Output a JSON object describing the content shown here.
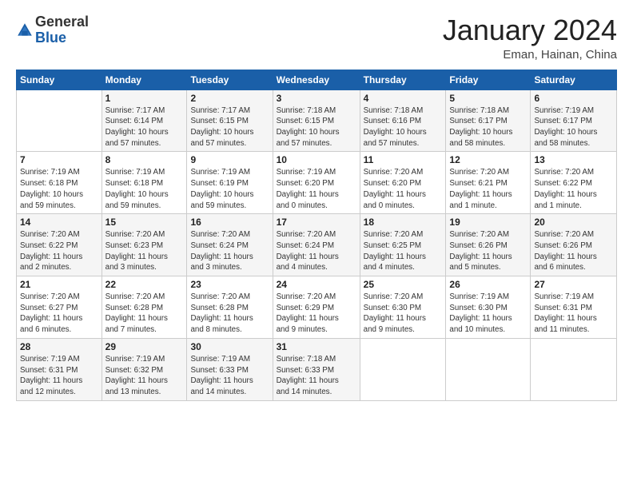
{
  "logo": {
    "general": "General",
    "blue": "Blue"
  },
  "title": {
    "month_year": "January 2024",
    "location": "Eman, Hainan, China"
  },
  "days_of_week": [
    "Sunday",
    "Monday",
    "Tuesday",
    "Wednesday",
    "Thursday",
    "Friday",
    "Saturday"
  ],
  "weeks": [
    [
      {
        "day": "",
        "info": ""
      },
      {
        "day": "1",
        "info": "Sunrise: 7:17 AM\nSunset: 6:14 PM\nDaylight: 10 hours\nand 57 minutes."
      },
      {
        "day": "2",
        "info": "Sunrise: 7:17 AM\nSunset: 6:15 PM\nDaylight: 10 hours\nand 57 minutes."
      },
      {
        "day": "3",
        "info": "Sunrise: 7:18 AM\nSunset: 6:15 PM\nDaylight: 10 hours\nand 57 minutes."
      },
      {
        "day": "4",
        "info": "Sunrise: 7:18 AM\nSunset: 6:16 PM\nDaylight: 10 hours\nand 57 minutes."
      },
      {
        "day": "5",
        "info": "Sunrise: 7:18 AM\nSunset: 6:17 PM\nDaylight: 10 hours\nand 58 minutes."
      },
      {
        "day": "6",
        "info": "Sunrise: 7:19 AM\nSunset: 6:17 PM\nDaylight: 10 hours\nand 58 minutes."
      }
    ],
    [
      {
        "day": "7",
        "info": "Sunrise: 7:19 AM\nSunset: 6:18 PM\nDaylight: 10 hours\nand 59 minutes."
      },
      {
        "day": "8",
        "info": "Sunrise: 7:19 AM\nSunset: 6:18 PM\nDaylight: 10 hours\nand 59 minutes."
      },
      {
        "day": "9",
        "info": "Sunrise: 7:19 AM\nSunset: 6:19 PM\nDaylight: 10 hours\nand 59 minutes."
      },
      {
        "day": "10",
        "info": "Sunrise: 7:19 AM\nSunset: 6:20 PM\nDaylight: 11 hours\nand 0 minutes."
      },
      {
        "day": "11",
        "info": "Sunrise: 7:20 AM\nSunset: 6:20 PM\nDaylight: 11 hours\nand 0 minutes."
      },
      {
        "day": "12",
        "info": "Sunrise: 7:20 AM\nSunset: 6:21 PM\nDaylight: 11 hours\nand 1 minute."
      },
      {
        "day": "13",
        "info": "Sunrise: 7:20 AM\nSunset: 6:22 PM\nDaylight: 11 hours\nand 1 minute."
      }
    ],
    [
      {
        "day": "14",
        "info": "Sunrise: 7:20 AM\nSunset: 6:22 PM\nDaylight: 11 hours\nand 2 minutes."
      },
      {
        "day": "15",
        "info": "Sunrise: 7:20 AM\nSunset: 6:23 PM\nDaylight: 11 hours\nand 3 minutes."
      },
      {
        "day": "16",
        "info": "Sunrise: 7:20 AM\nSunset: 6:24 PM\nDaylight: 11 hours\nand 3 minutes."
      },
      {
        "day": "17",
        "info": "Sunrise: 7:20 AM\nSunset: 6:24 PM\nDaylight: 11 hours\nand 4 minutes."
      },
      {
        "day": "18",
        "info": "Sunrise: 7:20 AM\nSunset: 6:25 PM\nDaylight: 11 hours\nand 4 minutes."
      },
      {
        "day": "19",
        "info": "Sunrise: 7:20 AM\nSunset: 6:26 PM\nDaylight: 11 hours\nand 5 minutes."
      },
      {
        "day": "20",
        "info": "Sunrise: 7:20 AM\nSunset: 6:26 PM\nDaylight: 11 hours\nand 6 minutes."
      }
    ],
    [
      {
        "day": "21",
        "info": "Sunrise: 7:20 AM\nSunset: 6:27 PM\nDaylight: 11 hours\nand 6 minutes."
      },
      {
        "day": "22",
        "info": "Sunrise: 7:20 AM\nSunset: 6:28 PM\nDaylight: 11 hours\nand 7 minutes."
      },
      {
        "day": "23",
        "info": "Sunrise: 7:20 AM\nSunset: 6:28 PM\nDaylight: 11 hours\nand 8 minutes."
      },
      {
        "day": "24",
        "info": "Sunrise: 7:20 AM\nSunset: 6:29 PM\nDaylight: 11 hours\nand 9 minutes."
      },
      {
        "day": "25",
        "info": "Sunrise: 7:20 AM\nSunset: 6:30 PM\nDaylight: 11 hours\nand 9 minutes."
      },
      {
        "day": "26",
        "info": "Sunrise: 7:19 AM\nSunset: 6:30 PM\nDaylight: 11 hours\nand 10 minutes."
      },
      {
        "day": "27",
        "info": "Sunrise: 7:19 AM\nSunset: 6:31 PM\nDaylight: 11 hours\nand 11 minutes."
      }
    ],
    [
      {
        "day": "28",
        "info": "Sunrise: 7:19 AM\nSunset: 6:31 PM\nDaylight: 11 hours\nand 12 minutes."
      },
      {
        "day": "29",
        "info": "Sunrise: 7:19 AM\nSunset: 6:32 PM\nDaylight: 11 hours\nand 13 minutes."
      },
      {
        "day": "30",
        "info": "Sunrise: 7:19 AM\nSunset: 6:33 PM\nDaylight: 11 hours\nand 14 minutes."
      },
      {
        "day": "31",
        "info": "Sunrise: 7:18 AM\nSunset: 6:33 PM\nDaylight: 11 hours\nand 14 minutes."
      },
      {
        "day": "",
        "info": ""
      },
      {
        "day": "",
        "info": ""
      },
      {
        "day": "",
        "info": ""
      }
    ]
  ]
}
